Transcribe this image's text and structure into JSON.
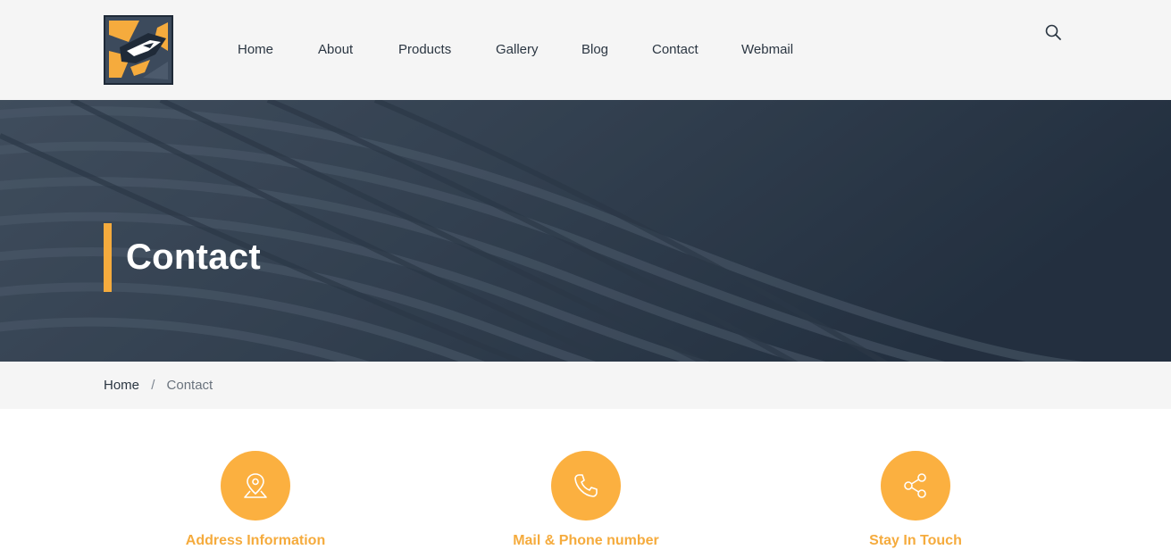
{
  "header": {
    "logo": {
      "icon": "wolf-logo-icon"
    },
    "nav": [
      {
        "label": "Home"
      },
      {
        "label": "About"
      },
      {
        "label": "Products"
      },
      {
        "label": "Gallery"
      },
      {
        "label": "Blog"
      },
      {
        "label": "Contact"
      },
      {
        "label": "Webmail"
      }
    ],
    "search": {
      "icon": "search-icon"
    }
  },
  "hero": {
    "title": "Contact",
    "accent_color": "#f5ab3d"
  },
  "breadcrumb": {
    "home": "Home",
    "separator": "/",
    "current": "Contact"
  },
  "info_cards": [
    {
      "icon": "map-pin-icon",
      "title": "Address Information"
    },
    {
      "icon": "phone-icon",
      "title": "Mail & Phone number"
    },
    {
      "icon": "share-icon",
      "title": "Stay In Touch"
    }
  ],
  "colors": {
    "accent": "#fbb040",
    "dark": "#2b3642",
    "hero_bg": "#2c3a4b"
  }
}
